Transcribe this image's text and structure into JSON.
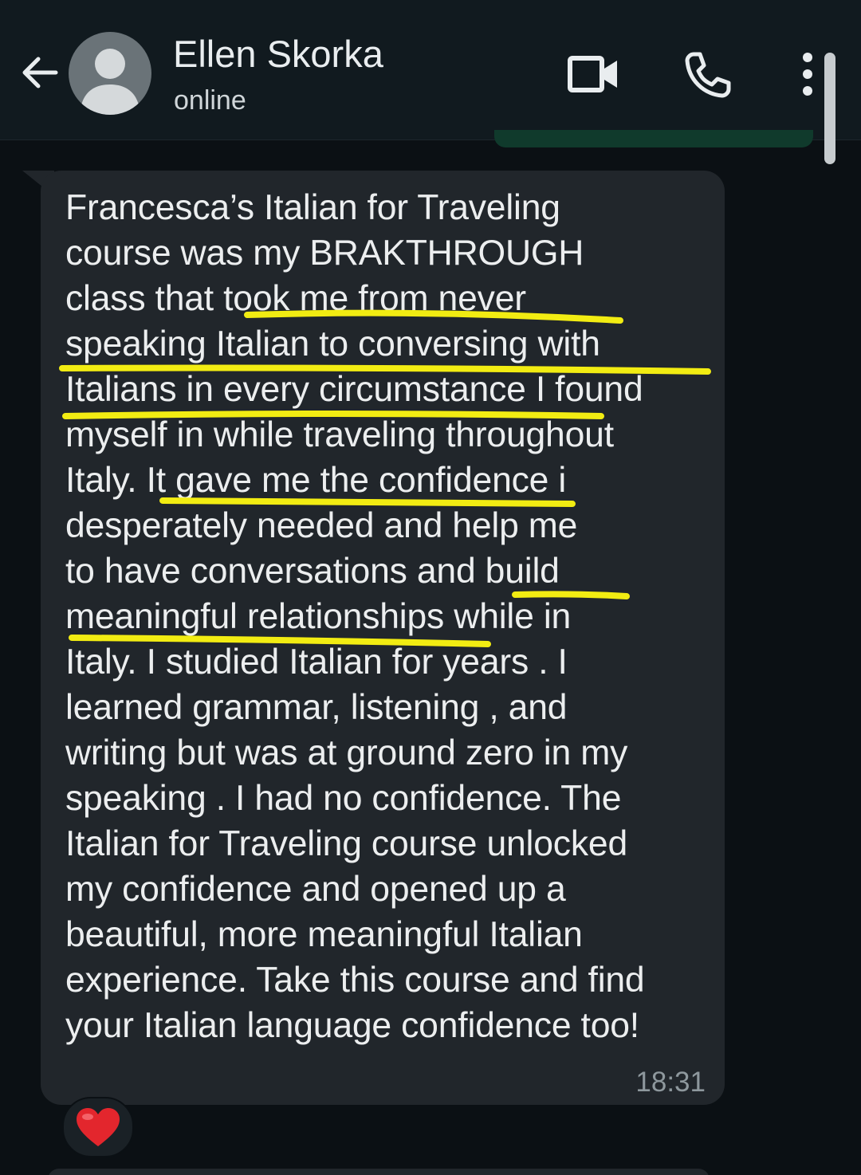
{
  "header": {
    "contact_name": "Ellen Skorka",
    "status": "online",
    "icons": [
      "back-arrow-icon",
      "avatar-placeholder-icon",
      "video-call-icon",
      "voice-call-icon",
      "more-options-icon"
    ]
  },
  "message": {
    "lines": [
      "Francesca’s Italian for Traveling",
      "course was my BRAKTHROUGH",
      "class that took me from never",
      "speaking Italian to conversing with",
      "Italians in every circumstance I found",
      "myself in while traveling throughout",
      "Italy. It gave me the confidence i",
      "desperately needed and help me",
      "to have conversations and build",
      "meaningful relationships while in",
      "Italy. I studied Italian for years . I",
      "learned grammar, listening , and",
      "writing but was at ground zero in my",
      "speaking . I had no confidence. The",
      "Italian for Traveling course unlocked",
      "my confidence and opened up a",
      "beautiful, more meaningful Italian",
      "experience. Take this course and find",
      "your Italian language confidence too!"
    ],
    "time": "18:31",
    "reaction": "❤️"
  },
  "colors": {
    "background": "#0b1014",
    "header": "#111a1f",
    "bubble": "#21262b",
    "text": "#eceeef",
    "highlight_underline": "#f2ec12",
    "timestamp": "#8e989d"
  }
}
